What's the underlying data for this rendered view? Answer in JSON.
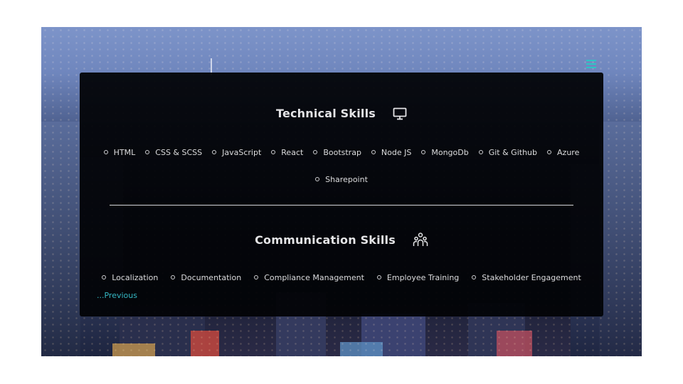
{
  "header": {
    "menu_icon": "hamburger-menu-icon",
    "accent": "#2ec4c4"
  },
  "technical": {
    "title": "Technical Skills",
    "icon": "monitor-icon",
    "skills": [
      "HTML",
      "CSS & SCSS",
      "JavaScript",
      "React",
      "Bootstrap",
      "Node JS",
      "MongoDb",
      "Git & Github",
      "Azure",
      "Sharepoint"
    ]
  },
  "communication": {
    "title": "Communication Skills",
    "icon": "people-group-icon",
    "skills": [
      "Localization",
      "Documentation",
      "Compliance Management",
      "Employee Training",
      "Stakeholder Engagement"
    ]
  },
  "navigation": {
    "previous_label": "...Previous",
    "link_color": "#35b8c4"
  }
}
